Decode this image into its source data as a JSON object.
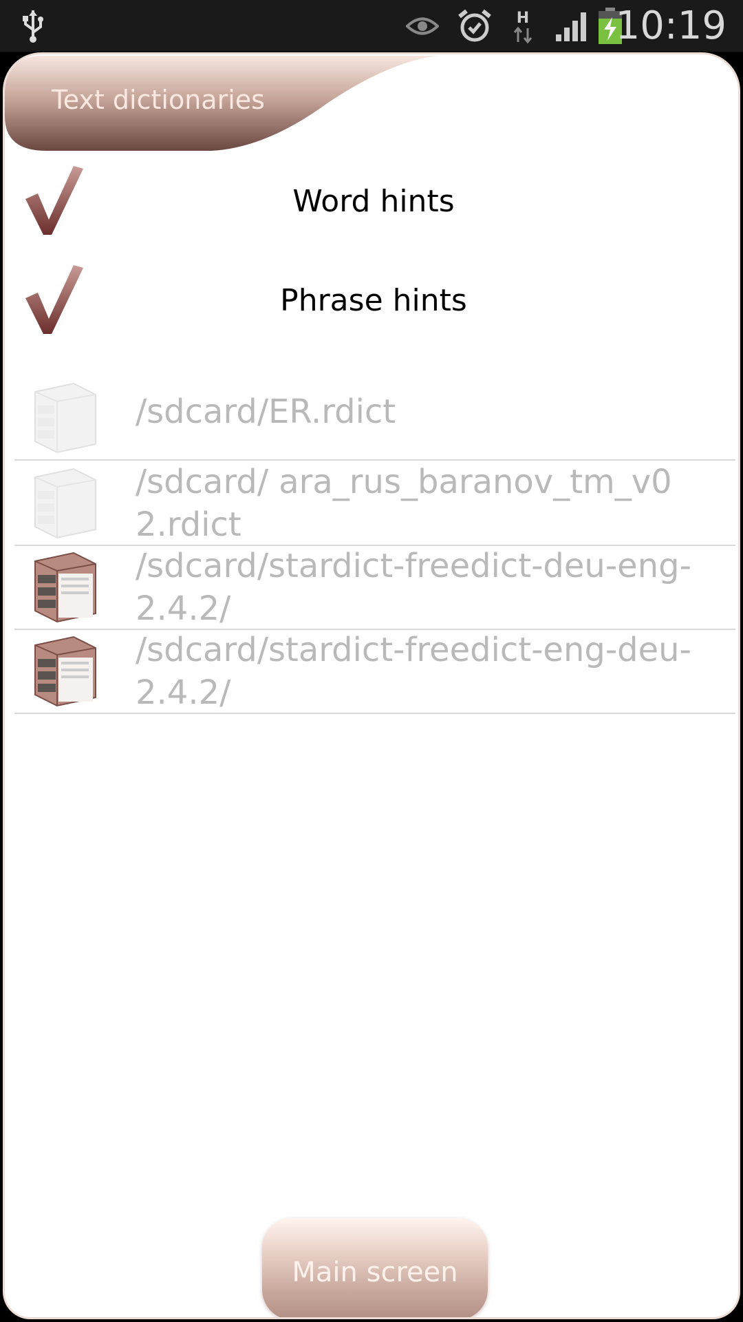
{
  "status_bar": {
    "time": "10:19",
    "icons": [
      "usb-icon",
      "eye-icon",
      "alarm-icon",
      "h-data-icon",
      "signal-icon",
      "battery-charging-icon"
    ],
    "data_label": "H"
  },
  "header": {
    "title": "Text dictionaries"
  },
  "hints": [
    {
      "label": "Word hints",
      "checked": true
    },
    {
      "label": "Phrase hints",
      "checked": true
    }
  ],
  "dictionaries": [
    {
      "path": "/sdcard/ER.rdict",
      "icon": "dictionary-cabinet-icon",
      "enabled": false
    },
    {
      "path": "/sdcard/ ara_rus_baranov_tm_v02.rdict",
      "icon": "dictionary-cabinet-icon",
      "enabled": false
    },
    {
      "path": "/sdcard/stardict-freedict-deu-eng-2.4.2/",
      "icon": "dictionary-cabinet-icon",
      "enabled": true
    },
    {
      "path": "/sdcard/stardict-freedict-eng-deu-2.4.2/",
      "icon": "dictionary-cabinet-icon",
      "enabled": true
    }
  ],
  "footer": {
    "main_button_label": "Main screen"
  },
  "colors": {
    "accent": "#7a3f3c",
    "title_tab_light": "#f3ddd4",
    "title_tab_dark": "#6e4a44",
    "disabled_text": "#b9b9b9"
  }
}
